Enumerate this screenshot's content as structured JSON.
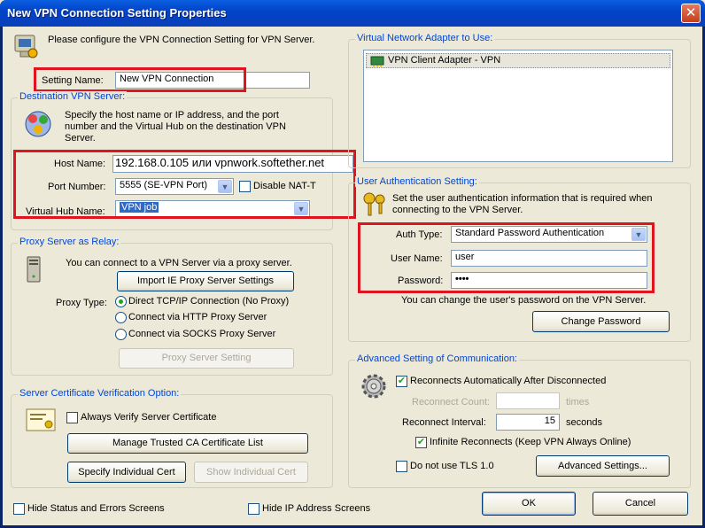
{
  "window": {
    "title": "New VPN Connection Setting Properties",
    "close_glyph": "✕"
  },
  "intro": {
    "text": "Please configure the VPN Connection Setting for VPN Server."
  },
  "setting_name": {
    "label": "Setting Name:",
    "value": "New VPN Connection"
  },
  "destination": {
    "legend": "Destination VPN Server:",
    "description": "Specify the host name or IP address, and the port number and the Virtual Hub on the destination VPN Server.",
    "host_label": "Host Name:",
    "host_value": "192.168.0.105 или vpnwork.softether.net",
    "port_label": "Port Number:",
    "port_value": "5555 (SE-VPN Port)",
    "disable_nat_label": "Disable NAT-T",
    "hub_label": "Virtual Hub Name:",
    "hub_value": "VPN job"
  },
  "proxy": {
    "legend": "Proxy Server as Relay:",
    "description": "You can connect to a VPN Server via a proxy server.",
    "import_button": "Import IE Proxy Server Settings",
    "type_label": "Proxy Type:",
    "options": [
      "Direct TCP/IP Connection (No Proxy)",
      "Connect via HTTP Proxy Server",
      "Connect via SOCKS Proxy Server"
    ],
    "selected_index": 0,
    "setting_button": "Proxy Server Setting"
  },
  "cert": {
    "legend": "Server Certificate Verification Option:",
    "always_verify_label": "Always Verify Server Certificate",
    "manage_button": "Manage Trusted CA Certificate List",
    "specify_button": "Specify Individual Cert",
    "show_button": "Show Individual Cert"
  },
  "bottom": {
    "hide_status_label": "Hide Status and Errors Screens",
    "hide_ip_label": "Hide IP Address Screens",
    "ok_button": "OK",
    "cancel_button": "Cancel"
  },
  "adapter": {
    "legend": "Virtual Network Adapter to Use:",
    "items": [
      "VPN Client Adapter - VPN"
    ]
  },
  "auth": {
    "legend": "User Authentication Setting:",
    "description": "Set the user authentication information that is required when connecting to the VPN Server.",
    "auth_type_label": "Auth Type:",
    "auth_type_value": "Standard Password Authentication",
    "user_label": "User Name:",
    "user_value": "user",
    "password_label": "Password:",
    "password_value": "••••",
    "change_note": "You can change the user's password on the VPN Server.",
    "change_button": "Change Password"
  },
  "advanced": {
    "legend": "Advanced Setting of Communication:",
    "reconnect_label": "Reconnects Automatically After Disconnected",
    "reconnect_count_label": "Reconnect Count:",
    "reconnect_count_value": "",
    "times_label": "times",
    "interval_label": "Reconnect Interval:",
    "interval_value": "15",
    "seconds_label": "seconds",
    "infinite_label": "Infinite Reconnects (Keep VPN Always Online)",
    "no_tls_label": "Do not use TLS 1.0",
    "advanced_button": "Advanced Settings..."
  },
  "colors": {
    "highlight_box": "#e0141e",
    "legend": "#0046d5",
    "title_bar": "#0244c9"
  }
}
